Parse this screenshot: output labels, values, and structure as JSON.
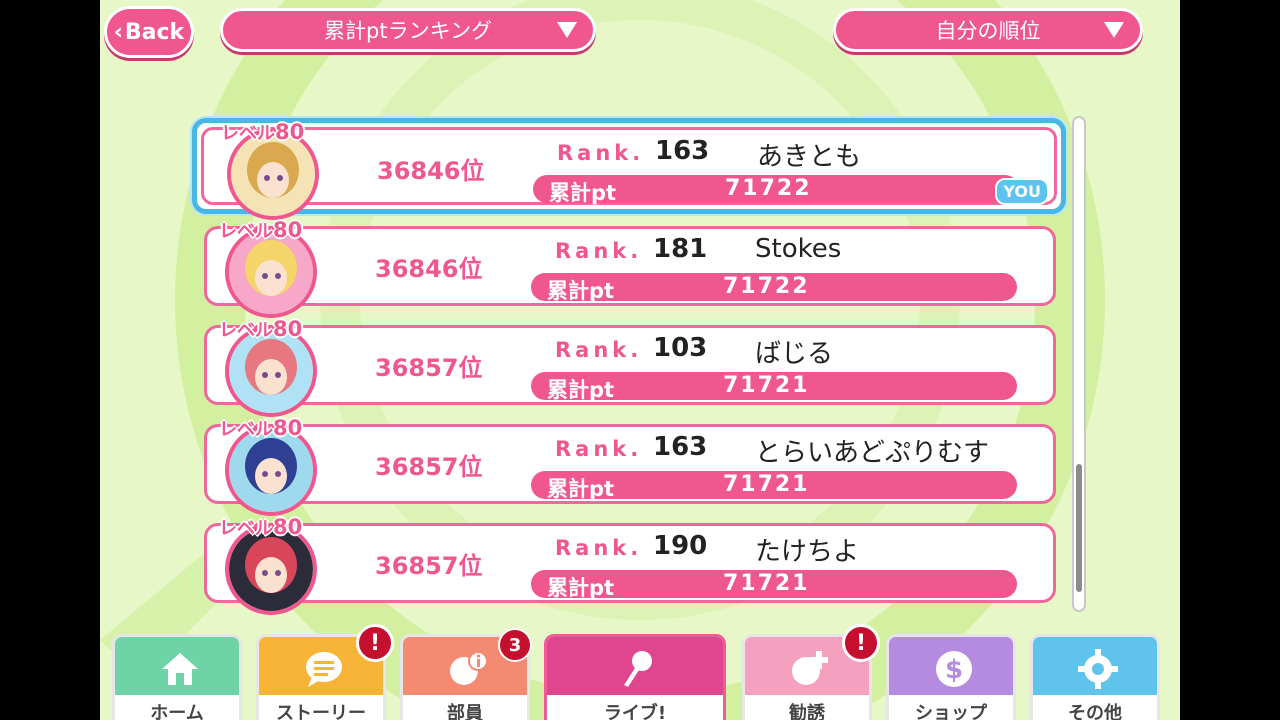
{
  "header": {
    "back_label": "Back",
    "ranking_dropdown": "累計ptランキング",
    "position_dropdown": "自分の順位"
  },
  "labels": {
    "level_prefix": "レベル",
    "rank_prefix": "Rank.",
    "pt_label": "累計pt",
    "you": "YOU"
  },
  "ranking": [
    {
      "level": "80",
      "position": "36846位",
      "rank": "163",
      "name": "あきとも",
      "pt": "71722",
      "self": true,
      "colors": [
        "#d9a84f",
        "#f6e3b5"
      ]
    },
    {
      "level": "80",
      "position": "36846位",
      "rank": "181",
      "name": "Stokes",
      "pt": "71722",
      "self": false,
      "colors": [
        "#f5d46a",
        "#f7a8c8"
      ]
    },
    {
      "level": "80",
      "position": "36857位",
      "rank": "103",
      "name": "ばじる",
      "pt": "71721",
      "self": false,
      "colors": [
        "#e8787f",
        "#aee2f4"
      ]
    },
    {
      "level": "80",
      "position": "36857位",
      "rank": "163",
      "name": "とらいあどぷりむす",
      "pt": "71721",
      "self": false,
      "colors": [
        "#2f3f93",
        "#9fd9ee"
      ]
    },
    {
      "level": "80",
      "position": "36857位",
      "rank": "190",
      "name": "たけちよ",
      "pt": "71721",
      "self": false,
      "colors": [
        "#d9465a",
        "#2b2b3a"
      ]
    }
  ],
  "nav": [
    {
      "label": "ホーム",
      "color": "#6fd3a8",
      "icon": "home-icon"
    },
    {
      "label": "ストーリー",
      "color": "#f7b437",
      "icon": "speech-bubble-icon",
      "badge": "!"
    },
    {
      "label": "部員",
      "color": "#f48a72",
      "icon": "member-info-icon",
      "badge": "3"
    },
    {
      "label": "ライブ!",
      "color": "#e0458f",
      "icon": "live-microphone-icon"
    },
    {
      "label": "勧誘",
      "color": "#f6a0c0",
      "icon": "recruit-plus-icon",
      "badge": "!"
    },
    {
      "label": "ショップ",
      "color": "#b48be0",
      "icon": "dollar-coin-icon"
    },
    {
      "label": "その他",
      "color": "#60c3ec",
      "icon": "gear-icon"
    }
  ]
}
